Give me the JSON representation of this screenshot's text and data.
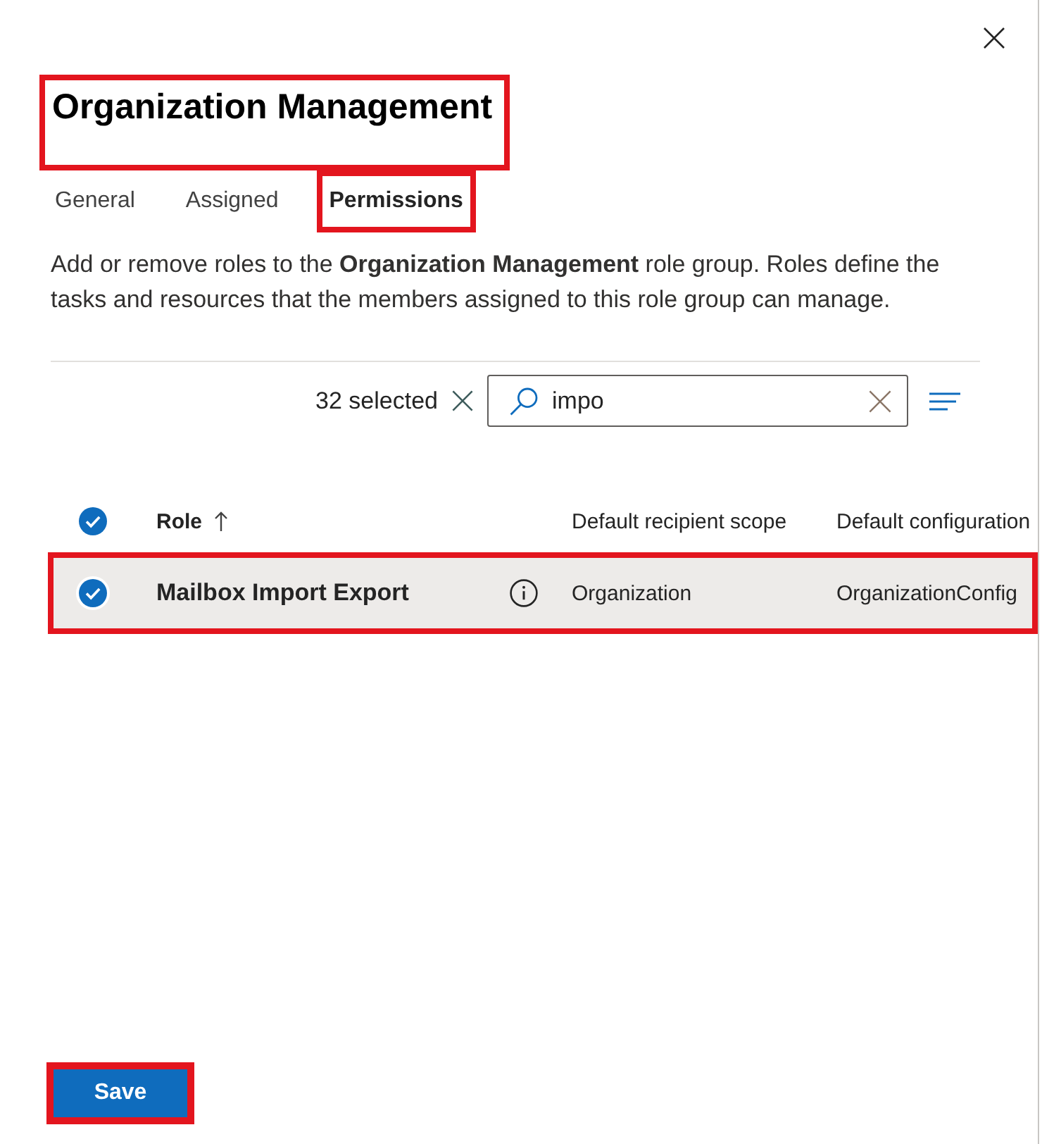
{
  "title": {
    "text": "Organization Management",
    "highlighted": true
  },
  "tabs": [
    {
      "label": "General",
      "selected": false,
      "highlighted": false
    },
    {
      "label": "Assigned",
      "selected": false,
      "highlighted": false
    },
    {
      "label": "Permissions",
      "selected": true,
      "highlighted": true
    }
  ],
  "description": "Add or remove roles to the **Organization Management** role group. Roles define the tasks and resources that the members assigned to this role group can manage.",
  "toolbar": {
    "selection_count": "32 selected",
    "search": {
      "value": "impo"
    }
  },
  "table": {
    "all_selected": true,
    "columns": [
      {
        "label": "Role",
        "sorted_ascending": true
      },
      {
        "label": "Default recipient scope"
      },
      {
        "label": "Default configuration"
      }
    ],
    "rows": [
      {
        "selected": true,
        "highlighted": true,
        "role": "Mailbox Import Export",
        "recipient_scope": "Organization",
        "configuration": "OrganizationConfig"
      }
    ]
  },
  "save_button": {
    "label": "Save",
    "highlighted": true
  }
}
